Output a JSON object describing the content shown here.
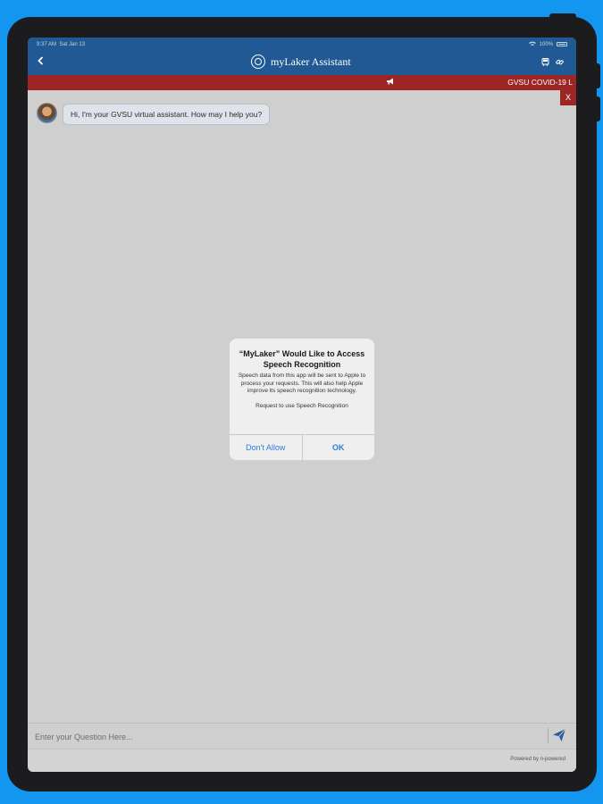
{
  "status_bar": {
    "time": "9:37 AM",
    "date": "Sat Jan 13",
    "battery": "100%"
  },
  "header": {
    "title": "myLaker Assistant"
  },
  "alert": {
    "text": "GVSU COVID-19 L",
    "close_label": "X"
  },
  "chat": {
    "messages": [
      {
        "sender": "bot",
        "text": "Hi, I'm your GVSU virtual assistant. How may I help you?"
      }
    ]
  },
  "dialog": {
    "title": "“MyLaker” Would Like to Access Speech Recognition",
    "message": "Speech data from this app will be sent to Apple to process your requests. This will also help Apple improve its speech recognition technology.",
    "request_text": "Request to use Speech Recognition",
    "deny_label": "Don't Allow",
    "ok_label": "OK"
  },
  "input": {
    "placeholder": "Enter your Question Here..."
  },
  "footer": {
    "powered_by": "Powered by n-powered"
  },
  "colors": {
    "header_blue": "#215994",
    "alert_red": "#9b2623",
    "device_bg": "#1296f0",
    "dialog_button_blue": "#2f7bd8"
  }
}
